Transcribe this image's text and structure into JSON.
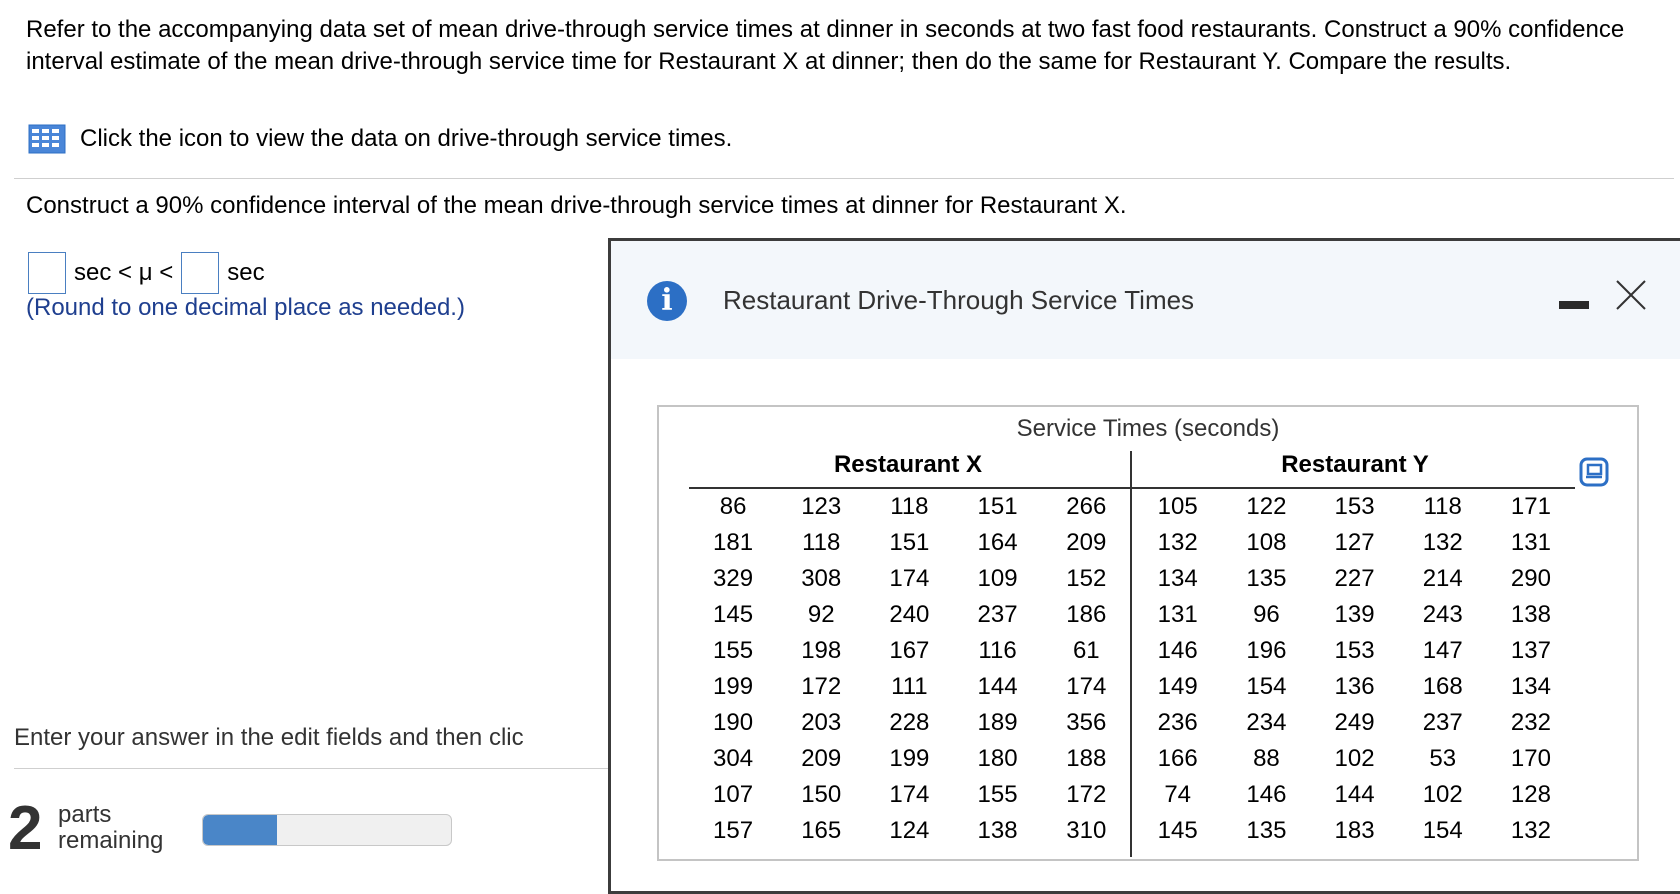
{
  "prompt": {
    "intro": "Refer to the accompanying data set of mean drive-through service times at dinner in seconds at two fast food restaurants. Construct a 90% confidence interval estimate of the mean drive-through service time for Restaurant X at dinner; then do the same for Restaurant Y. Compare the results.",
    "icon_link": "Click the icon to view the data on drive-through service times.",
    "question": "Construct a 90% confidence interval of the mean drive-through service times at dinner for Restaurant X.",
    "answer_middle": "sec < μ <",
    "answer_end": "sec",
    "round_note": "(Round to one decimal place as needed.)",
    "enter_text": "Enter your answer in the edit fields and then clic",
    "parts_num": "2",
    "parts_line1": "parts",
    "parts_line2": "remaining",
    "progress_fraction": 0.3
  },
  "dialog": {
    "info_glyph": "i",
    "title": "Restaurant Drive-Through Service Times",
    "caption": "Service Times (seconds)",
    "group_x": "Restaurant X",
    "group_y": "Restaurant Y",
    "rows": [
      [
        "86",
        "123",
        "118",
        "151",
        "266",
        "105",
        "122",
        "153",
        "118",
        "171"
      ],
      [
        "181",
        "118",
        "151",
        "164",
        "209",
        "132",
        "108",
        "127",
        "132",
        "131"
      ],
      [
        "329",
        "308",
        "174",
        "109",
        "152",
        "134",
        "135",
        "227",
        "214",
        "290"
      ],
      [
        "145",
        "92",
        "240",
        "237",
        "186",
        "131",
        "96",
        "139",
        "243",
        "138"
      ],
      [
        "155",
        "198",
        "167",
        "116",
        "61",
        "146",
        "196",
        "153",
        "147",
        "137"
      ],
      [
        "199",
        "172",
        "111",
        "144",
        "174",
        "149",
        "154",
        "136",
        "168",
        "134"
      ],
      [
        "190",
        "203",
        "228",
        "189",
        "356",
        "236",
        "234",
        "249",
        "237",
        "232"
      ],
      [
        "304",
        "209",
        "199",
        "180",
        "188",
        "166",
        "88",
        "102",
        "53",
        "170"
      ],
      [
        "107",
        "150",
        "174",
        "155",
        "172",
        "74",
        "146",
        "144",
        "102",
        "128"
      ],
      [
        "157",
        "165",
        "124",
        "138",
        "310",
        "145",
        "135",
        "183",
        "154",
        "132"
      ]
    ]
  },
  "colors": {
    "accent_blue": "#2c6fc5",
    "note_blue": "#1f3f8f",
    "progress_blue": "#4a86c8"
  },
  "icons": [
    "data-grid-icon",
    "info-icon",
    "minimize-icon",
    "close-icon",
    "copy-icon"
  ]
}
